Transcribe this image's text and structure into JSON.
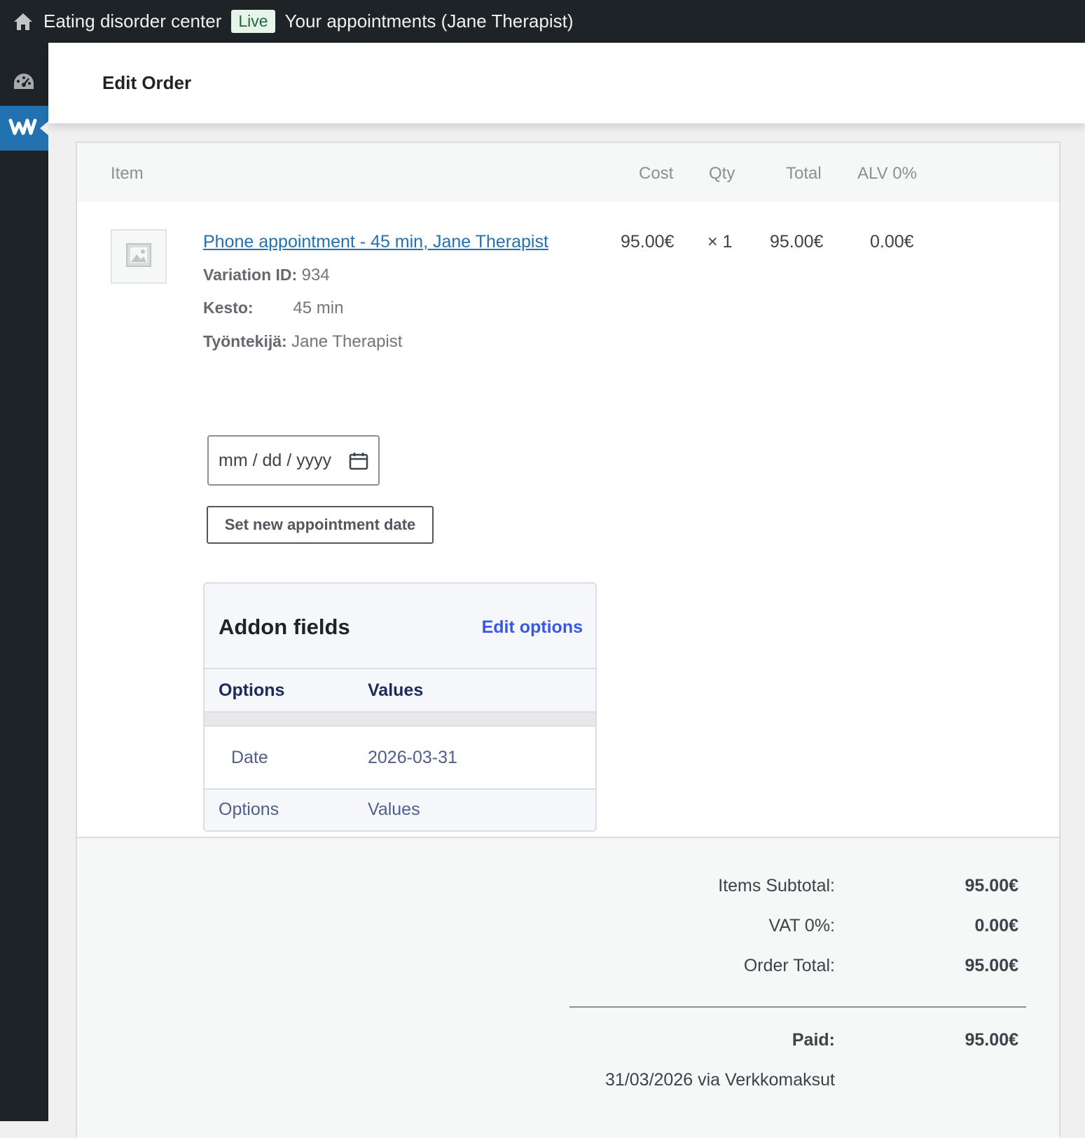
{
  "adminbar": {
    "site_name": "Eating disorder center",
    "live_badge": "Live",
    "appointments_link": "Your appointments (Jane Therapist)"
  },
  "page": {
    "title": "Edit Order"
  },
  "table": {
    "headers": {
      "item": "Item",
      "cost": "Cost",
      "qty": "Qty",
      "total": "Total",
      "tax": "ALV 0%"
    }
  },
  "line_item": {
    "name": "Phone appointment - 45 min, Jane Therapist",
    "cost": "95.00€",
    "qty": "× 1",
    "total": "95.00€",
    "tax": "0.00€",
    "variation_label": "Variation ID:",
    "variation_value": "934",
    "kesto_label": "Kesto:",
    "kesto_value": "45 min",
    "employee_label": "Työntekijä:",
    "employee_value": "Jane Therapist",
    "date_placeholder": "mm / dd / yyyy",
    "set_date_button": "Set new appointment date"
  },
  "addon": {
    "title": "Addon fields",
    "edit_link": "Edit options",
    "col_options": "Options",
    "col_values": "Values",
    "rows": [
      {
        "option": "Date",
        "value": "2026-03-31"
      }
    ],
    "footer_options": "Options",
    "footer_values": "Values"
  },
  "totals": {
    "subtotal_label": "Items Subtotal:",
    "subtotal_value": "95.00€",
    "vat_label": "VAT 0%:",
    "vat_value": "0.00€",
    "order_total_label": "Order Total:",
    "order_total_value": "95.00€",
    "paid_label": "Paid:",
    "paid_value": "95.00€",
    "paid_note": "31/03/2026 via Verkkomaksut"
  },
  "colors": {
    "adminbar": "#1d2327",
    "accent": "#2271b1",
    "addon_link": "#3858e9"
  }
}
